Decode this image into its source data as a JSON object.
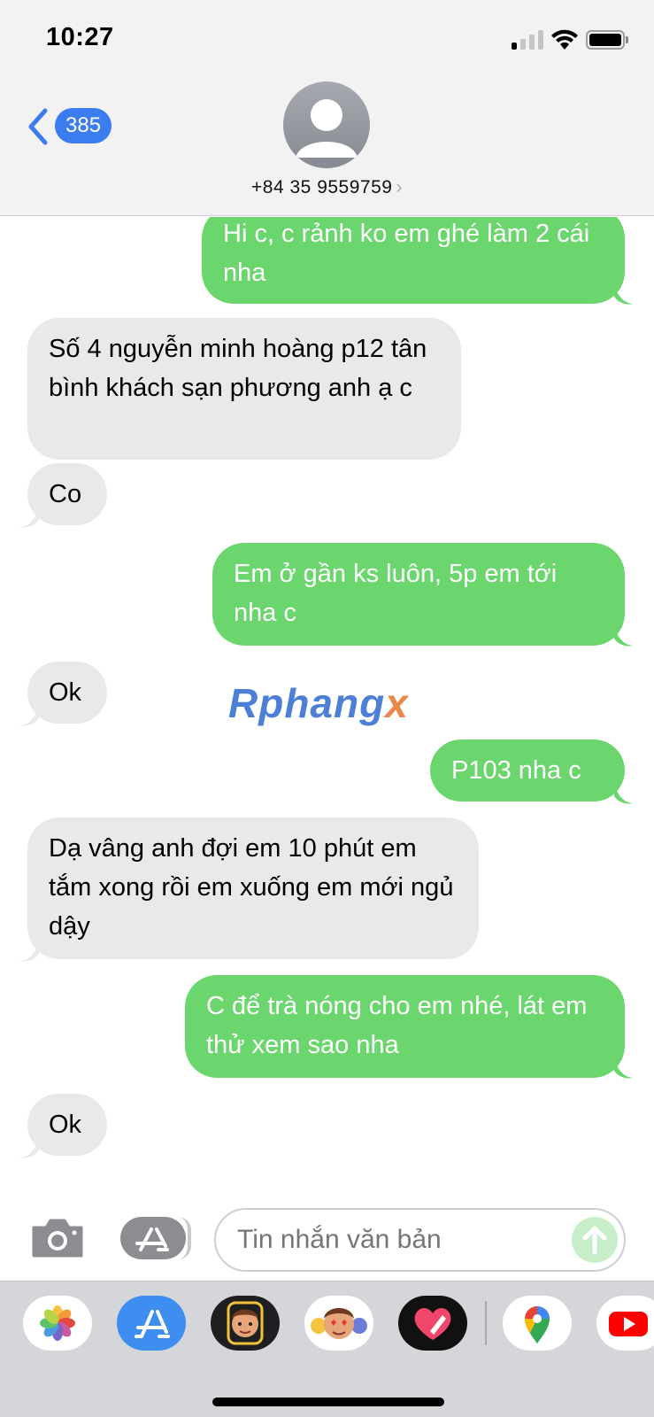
{
  "status_bar": {
    "time": "10:27",
    "signal_bars_active": 1,
    "signal_bars_total": 4
  },
  "header": {
    "back_count": "385",
    "contact_number": "+84 35 9559759",
    "chevron": "›",
    "accent_color": "#3b7cf0"
  },
  "messages": [
    {
      "direction": "out",
      "text": "Hi c, c rảnh ko em ghé làm 2 cái nha"
    },
    {
      "direction": "in",
      "text": "Số 4 nguyễn minh hoàng p12 tân bình khách sạn phương anh ạ c"
    },
    {
      "direction": "in",
      "text": "Co"
    },
    {
      "direction": "out",
      "text": "Em ở gần ks luôn, 5p em tới nha c"
    },
    {
      "direction": "in",
      "text": "Ok"
    },
    {
      "direction": "out",
      "text": "P103 nha c"
    },
    {
      "direction": "in",
      "text": "Dạ vâng anh đợi em 10 phút em tắm xong rồi em xuống em mới ngủ dậy"
    },
    {
      "direction": "out",
      "text": "C để trà nóng cho em nhé, lát em thử xem sao nha"
    },
    {
      "direction": "in",
      "text": "Ok"
    }
  ],
  "watermark": {
    "main": "Rphang",
    "suffix": "x"
  },
  "compose": {
    "placeholder": "Tin nhắn văn bản",
    "outgoing_color": "#6bd66d",
    "incoming_color": "#e9e9eb"
  },
  "drawer": {
    "apps": [
      "photos-icon",
      "app-store-icon",
      "memoji-camera-icon",
      "memoji-stickers-icon",
      "digital-touch-icon",
      "google-maps-icon",
      "youtube-icon"
    ]
  }
}
